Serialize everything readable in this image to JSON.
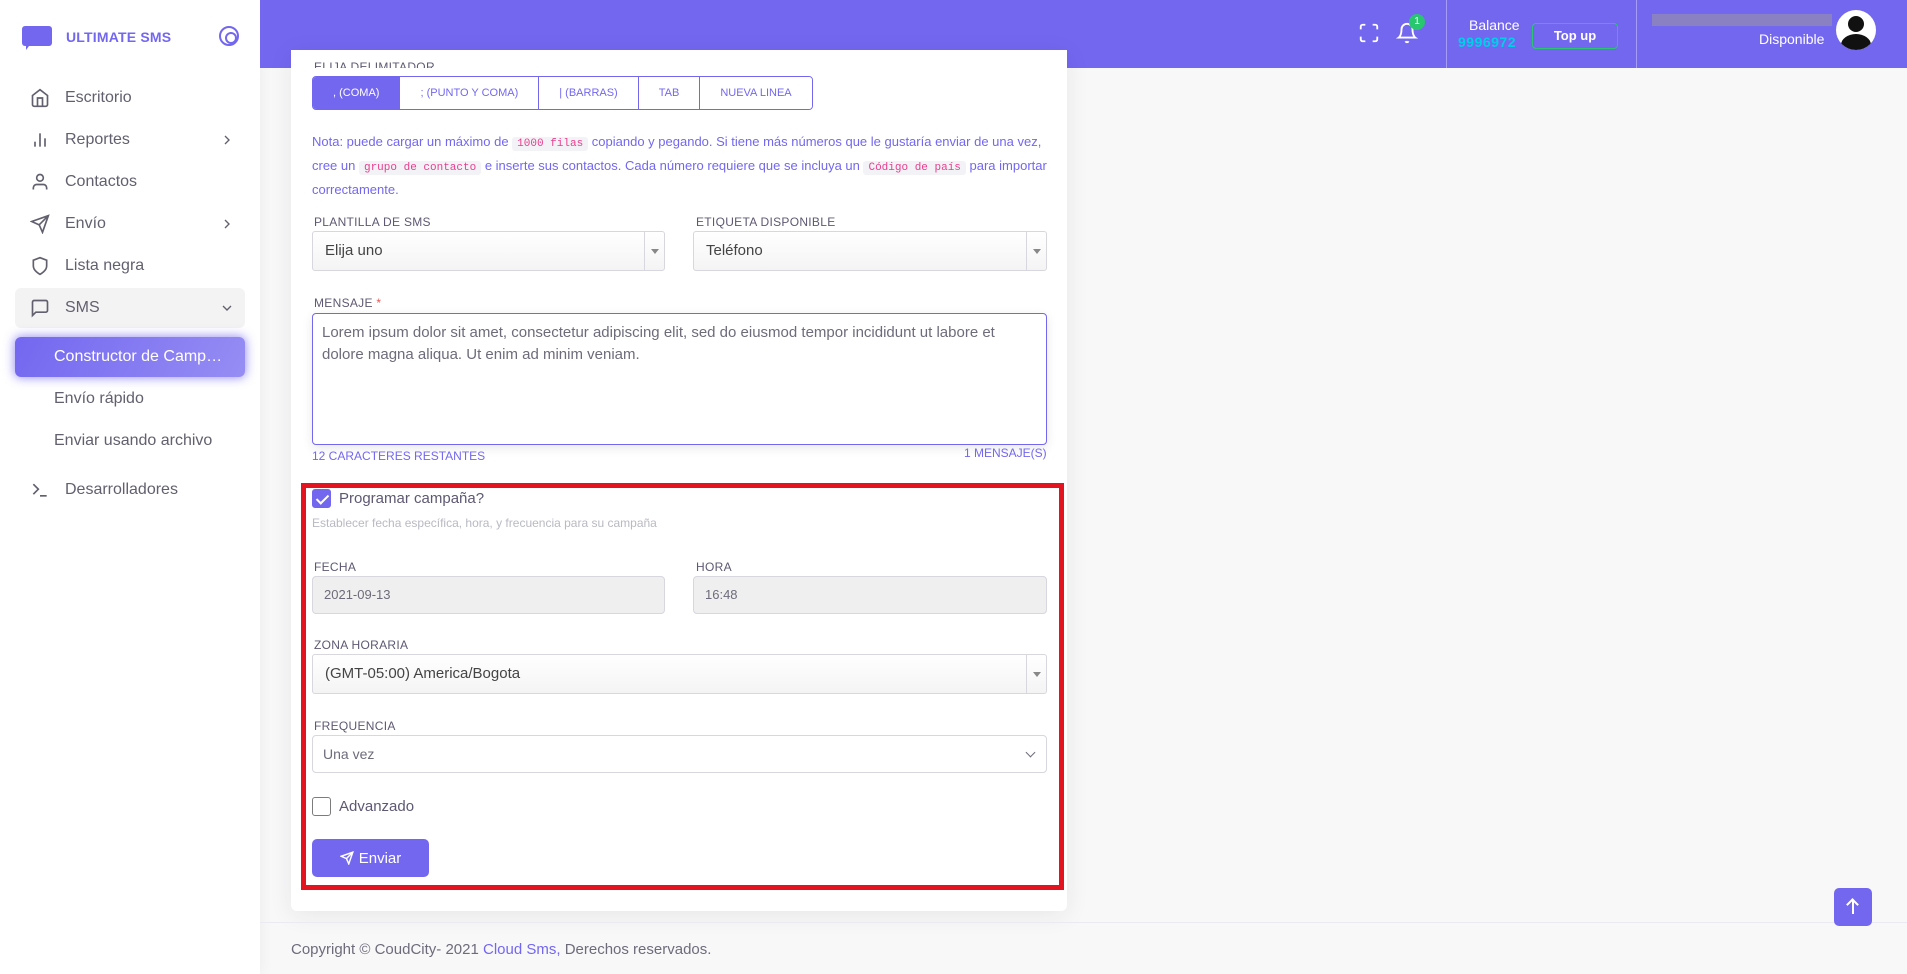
{
  "brand": {
    "name": "ULTIMATE SMS"
  },
  "sidebar": {
    "items": [
      {
        "label": "Escritorio",
        "icon": "home-icon"
      },
      {
        "label": "Reportes",
        "icon": "bar-chart-icon"
      },
      {
        "label": "Contactos",
        "icon": "user-icon"
      },
      {
        "label": "Envío",
        "icon": "send-icon"
      },
      {
        "label": "Lista negra",
        "icon": "shield-icon"
      },
      {
        "label": "SMS",
        "icon": "message-square-icon"
      }
    ],
    "sms_sub": [
      {
        "label": "Constructor de Campaña"
      },
      {
        "label": "Envío rápido"
      },
      {
        "label": "Enviar usando archivo"
      }
    ],
    "dev": {
      "label": "Desarrolladores",
      "icon": "terminal-icon"
    }
  },
  "header": {
    "notification_count": "1",
    "balance_label": "Balance",
    "balance_value": "9996972",
    "topup_label": "Top up",
    "user_status": "Disponible"
  },
  "form": {
    "delimiter_label": "ELIJA DELIMITADOR",
    "delimiters": [
      ", (COMA)",
      "; (PUNTO Y COMA)",
      "| (BARRAS)",
      "TAB",
      "NUEVA LINEA"
    ],
    "note": {
      "part1": "Nota: puede cargar un máximo de ",
      "code1": "1000 filas",
      "part2": " copiando y pegando. Si tiene más números que le gustaría enviar de una vez, cree un ",
      "code2": "grupo de contacto",
      "part3": " e inserte sus contactos. Cada número requiere que se incluya un ",
      "code3": "Código de país",
      "part4": " para importar correctamente."
    },
    "template_label": "PLANTILLA DE SMS",
    "template_value": "Elija uno",
    "tag_label": "ETIQUETA DISPONIBLE",
    "tag_value": "Teléfono",
    "message_label": "MENSAJE",
    "message_value": "Lorem ipsum dolor sit amet, consectetur adipiscing elit, sed do eiusmod tempor incididunt ut labore et dolore magna aliqua. Ut enim ad minim veniam.",
    "chars_remaining": "12 CARACTERES RESTANTES",
    "message_count": "1 MENSAJE(S)",
    "schedule_label": "Programar campaña?",
    "schedule_help": "Establecer fecha específica, hora, y frecuencia para su campaña",
    "date_label": "FECHA",
    "date_value": "2021-09-13",
    "time_label": "HORA",
    "time_value": "16:48",
    "timezone_label": "ZONA HORARIA",
    "timezone_value": "(GMT-05:00) America/Bogota",
    "frequency_label": "FREQUENCIA",
    "frequency_value": "Una vez",
    "advanced_label": "Advanzado",
    "send_label": "Enviar"
  },
  "footer": {
    "copyright": "Copyright © CoudCity- 2021",
    "link": "Cloud Sms,",
    "rights": "Derechos reservados."
  }
}
